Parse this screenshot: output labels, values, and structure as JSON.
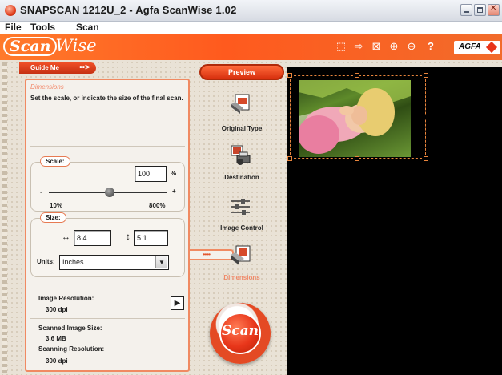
{
  "window": {
    "title": "SNAPSCAN 1212U_2 - Agfa ScanWise 1.02"
  },
  "menu": [
    {
      "label": "File"
    },
    {
      "label": "Tools"
    },
    {
      "label": "Scan"
    }
  ],
  "brand": {
    "logo_scan": "Scan",
    "logo_wise": "Wise",
    "vendor": "AGFA"
  },
  "toolbar_icons": [
    "select-area-icon",
    "arrow-right-icon",
    "fit-icon",
    "zoom-in-icon",
    "zoom-out-icon",
    "help-icon"
  ],
  "toolbar_help_glyph": "?",
  "guide": {
    "label": "Guide Me",
    "arrow": "••>"
  },
  "panel": {
    "title": "Dimensions",
    "instruction": "Set the scale, or indicate the size of the final scan.",
    "scale": {
      "label": "Scale:",
      "value": "100",
      "unit": "%",
      "min_label": "10%",
      "max_label": "800%",
      "minus": "-",
      "plus": "+"
    },
    "size": {
      "label": "Size:",
      "width": "8.4",
      "height": "5.1",
      "width_glyph": "↔",
      "height_glyph": "↕"
    },
    "units": {
      "label": "Units:",
      "value": "Inches"
    },
    "resolution": {
      "label": "Image Resolution:",
      "value": "300 dpi"
    },
    "scanned_size": {
      "label": "Scanned Image Size:",
      "value": "3.6 MB"
    },
    "scanning_resolution": {
      "label": "Scanning Resolution:",
      "value": "300 dpi"
    }
  },
  "steps": {
    "preview": "Preview",
    "original_type": "Original Type",
    "destination": "Destination",
    "image_control": "Image Control",
    "dimensions": "Dimensions",
    "arrow_tab": "•••••"
  },
  "scan_button": "Scan",
  "colors": {
    "accent": "#ff5a1e",
    "panel_border": "#f08a62",
    "preview_bg": "#000000"
  }
}
